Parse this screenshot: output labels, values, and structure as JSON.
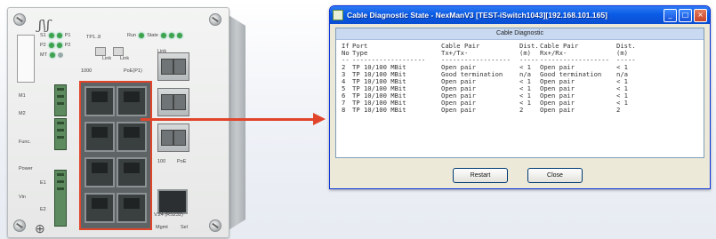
{
  "device": {
    "logo": "ʃ\\ʃ",
    "led_labels": [
      "S1",
      "P1",
      "P2",
      "P2",
      "MT",
      "TP1..8",
      "Run",
      "State",
      "Link"
    ],
    "slot_labels": [
      "M1",
      "M2",
      "Func."
    ],
    "port_labels": [
      "1000",
      "PoE(P1)",
      "100",
      "PoE",
      "Link",
      "Link"
    ],
    "power_labels": [
      "Power",
      "Vin",
      "E1",
      "E2"
    ],
    "serial_label": "V.24 (RS232)",
    "bottom_labels": [
      "Mgmt",
      "Sel"
    ]
  },
  "window": {
    "title": "Cable Diagnostic State - NexManV3 [TEST-iSwitch1043][192.168.101.165]",
    "panel_header": "Cable Diagnostic",
    "buttons": {
      "restart": "Restart",
      "close": "Close"
    },
    "titlebar_buttons": {
      "minimize": "_",
      "maximize": "□",
      "close": "×"
    }
  },
  "table": {
    "header1": [
      "If",
      "Port",
      "Cable Pair",
      "Dist.",
      "Cable Pair",
      "Dist."
    ],
    "header2": [
      "No",
      "Type",
      "Tx+/Tx-",
      "(m)",
      "Rx+/Rx-",
      "(m)"
    ],
    "divider": [
      "--",
      "-------------------",
      "------------------",
      "-----",
      "------------------",
      "-----"
    ],
    "rows": [
      [
        "2",
        "TP 10/100 MBit",
        "Open pair",
        "< 1",
        "Open pair",
        "< 1"
      ],
      [
        "3",
        "TP 10/100 MBit",
        "Good termination",
        "n/a",
        "Good termination",
        "n/a"
      ],
      [
        "4",
        "TP 10/100 MBit",
        "Open pair",
        "< 1",
        "Open pair",
        "< 1"
      ],
      [
        "5",
        "TP 10/100 MBit",
        "Open pair",
        "< 1",
        "Open pair",
        "< 1"
      ],
      [
        "6",
        "TP 10/100 MBit",
        "Open pair",
        "< 1",
        "Open pair",
        "< 1"
      ],
      [
        "7",
        "TP 10/100 MBit",
        "Open pair",
        "< 1",
        "Open pair",
        "< 1"
      ],
      [
        "8",
        "TP 10/100 MBit",
        "Open pair",
        "2",
        "Open pair",
        "2"
      ]
    ]
  },
  "colors": {
    "arrow": "#e0452b",
    "titlebar": "#0b5ce6",
    "led_green": "#3fa34d"
  }
}
